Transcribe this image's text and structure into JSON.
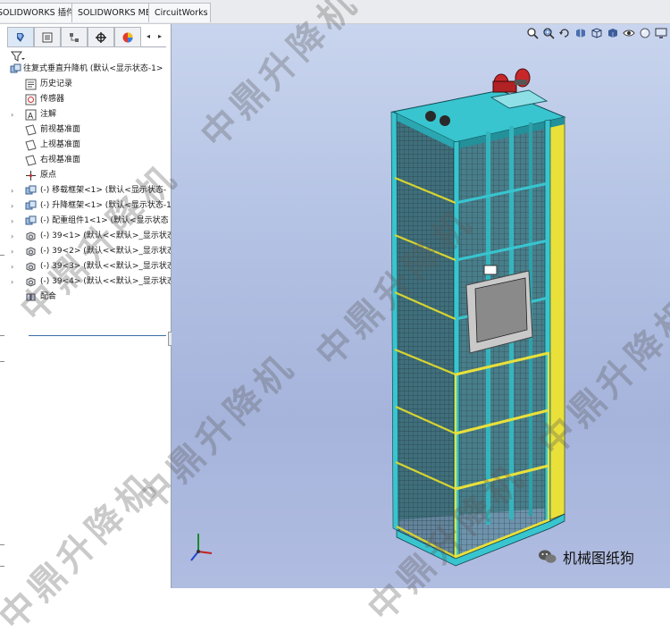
{
  "tabs": [
    {
      "label": "SOLIDWORKS 插件"
    },
    {
      "label": "SOLIDWORKS MBD"
    },
    {
      "label": "CircuitWorks"
    }
  ],
  "tree": {
    "root": "往复式垂直升降机  (默认<显示状态-1>",
    "items": [
      {
        "label": "历史记录",
        "icon": "history-icon",
        "expander": ""
      },
      {
        "label": "传感器",
        "icon": "sensor-icon",
        "expander": ""
      },
      {
        "label": "注解",
        "icon": "annotation-icon",
        "expander": "›"
      },
      {
        "label": "前视基准面",
        "icon": "plane-icon",
        "expander": ""
      },
      {
        "label": "上视基准面",
        "icon": "plane-icon",
        "expander": ""
      },
      {
        "label": "右视基准面",
        "icon": "plane-icon",
        "expander": ""
      },
      {
        "label": "原点",
        "icon": "origin-icon",
        "expander": ""
      },
      {
        "label": "(-) 移载框架<1> (默认<显示状态-",
        "icon": "subassembly-icon",
        "expander": "›"
      },
      {
        "label": "(-) 升降框架<1> (默认<显示状态-1",
        "icon": "subassembly-icon",
        "expander": "›"
      },
      {
        "label": "(-) 配重组件1<1> (默认<显示状态",
        "icon": "subassembly-icon",
        "expander": "›"
      },
      {
        "label": "(-) 39<1> (默认<<默认>_显示状态",
        "icon": "part-icon",
        "expander": "›"
      },
      {
        "label": "(-) 39<2> (默认<<默认>_显示状态",
        "icon": "part-icon",
        "expander": "›"
      },
      {
        "label": "(-) 39<3> (默认<<默认>_显示状态",
        "icon": "part-icon",
        "expander": "›"
      },
      {
        "label": "(-) 39<4> (默认<<默认>_显示状态",
        "icon": "part-icon",
        "expander": "›"
      },
      {
        "label": "配合",
        "icon": "mates-icon",
        "expander": ""
      }
    ]
  },
  "watermark": "中鼎升降机",
  "brand": "机械图纸狗",
  "colors": {
    "frame_cyan": "#38c5cf",
    "frame_yellow": "#e9e03a",
    "motor_red": "#c8272a",
    "mesh_dark": "#1a2a32"
  }
}
